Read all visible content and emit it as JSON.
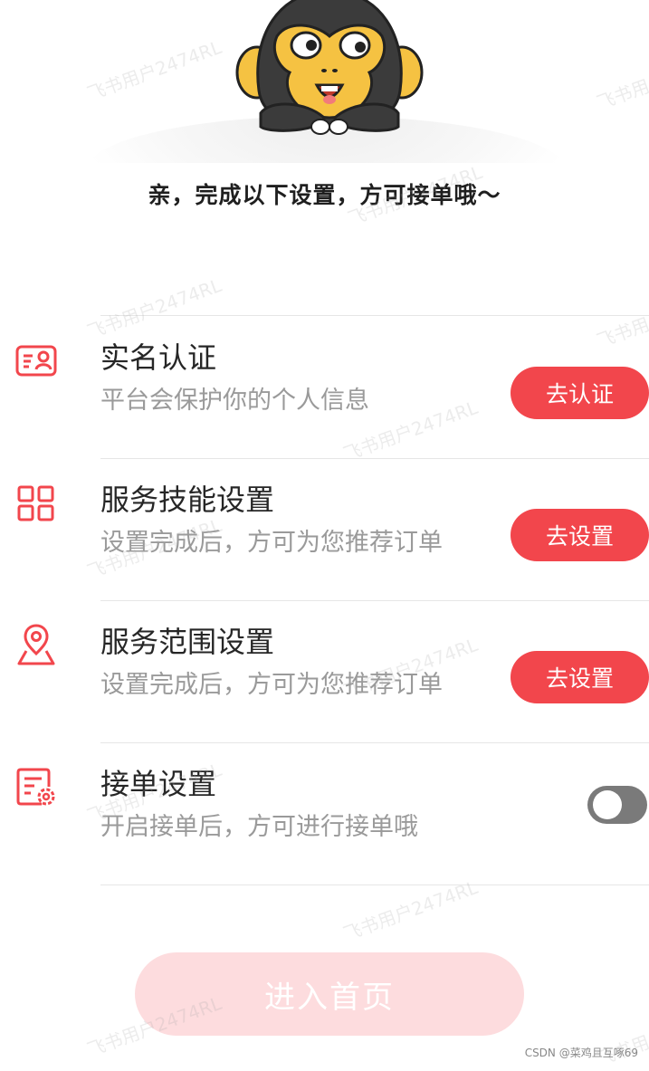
{
  "headline": "亲，完成以下设置，方可接单哦～",
  "accent_color": "#f2464c",
  "items": [
    {
      "icon": "id-card-icon",
      "title": "实名认证",
      "desc": "平台会保护你的个人信息",
      "action": "去认证"
    },
    {
      "icon": "grid-icon",
      "title": "服务技能设置",
      "desc": "设置完成后，方可为您推荐订单",
      "action": "去设置"
    },
    {
      "icon": "location-pin-icon",
      "title": "服务范围设置",
      "desc": "设置完成后，方可为您推荐订单",
      "action": "去设置"
    },
    {
      "icon": "document-gear-icon",
      "title": "接单设置",
      "desc": "开启接单后，方可进行接单哦",
      "toggle_on": false
    }
  ],
  "enter_button": "进入首页",
  "watermark": "飞书用户2474RL",
  "credit": "CSDN @菜鸡且互啄69"
}
